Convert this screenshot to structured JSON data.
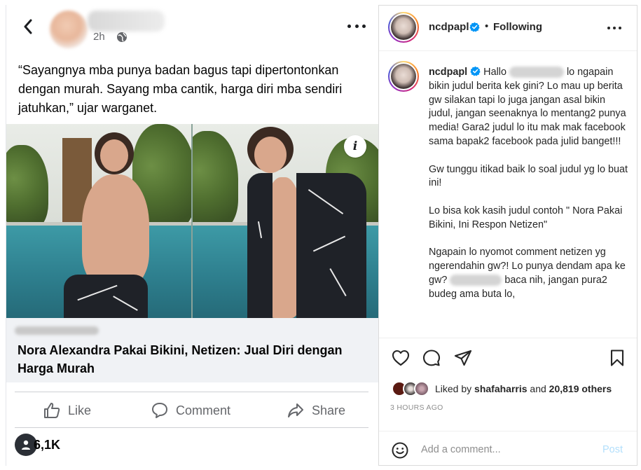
{
  "facebook": {
    "time": "2h",
    "caption": "“Sayangnya mba punya badan bagus tapi dipertontonkan dengan murah. Sayang mba cantik, harga diri mba sendiri jatuhkan,” ujar warganet.",
    "info_glyph": "i",
    "link_title": "Nora Alexandra Pakai Bikini, Netizen: Jual Diri dengan Harga Murah",
    "actions": {
      "like": "Like",
      "comment": "Comment",
      "share": "Share"
    },
    "reactions_count": "6,1K",
    "icons": [
      "back-arrow-icon",
      "globe-icon",
      "more-icon",
      "info-icon",
      "like-icon",
      "comment-icon",
      "share-icon",
      "user-icon"
    ]
  },
  "instagram": {
    "username": "ncdpapl",
    "separator": "•",
    "following": "Following",
    "comment": {
      "user": "ncdpapl",
      "part1": "Hallo ",
      "part2": " lo ngapain bikin judul berita kek gini? Lo mau up berita gw silakan tapi lo juga jangan asal bikin judul, jangan seenaknya lo mentang2 punya media! Gara2 judul lo itu mak mak facebook sama bapak2 facebook pada julid banget!!!\n\nGw tunggu itikad baik lo soal judul yg lo buat ini!\n\nLo bisa kok kasih judul contoh \" Nora Pakai Bikini, Ini Respon Netizen\"\n\nNgapain lo nyomot comment netizen yg ngerendahin gw?! Lo punya dendam apa ke gw? ",
      "part3": " baca nih, jangan pura2 budeg ama buta lo,"
    },
    "likes": {
      "prefix": "Liked by ",
      "user": "shafaharris",
      "and": " and ",
      "others": "20,819 others"
    },
    "timestamp": "3 HOURS AGO",
    "add_comment_placeholder": "Add a comment...",
    "post_label": "Post",
    "icons": [
      "verified-icon",
      "more-icon",
      "heart-icon",
      "comment-icon",
      "share-icon",
      "bookmark-icon",
      "smile-icon"
    ],
    "colors": {
      "verified": "#0095f6",
      "post_disabled": "#b2dffc",
      "muted": "#8e8e8e"
    }
  }
}
